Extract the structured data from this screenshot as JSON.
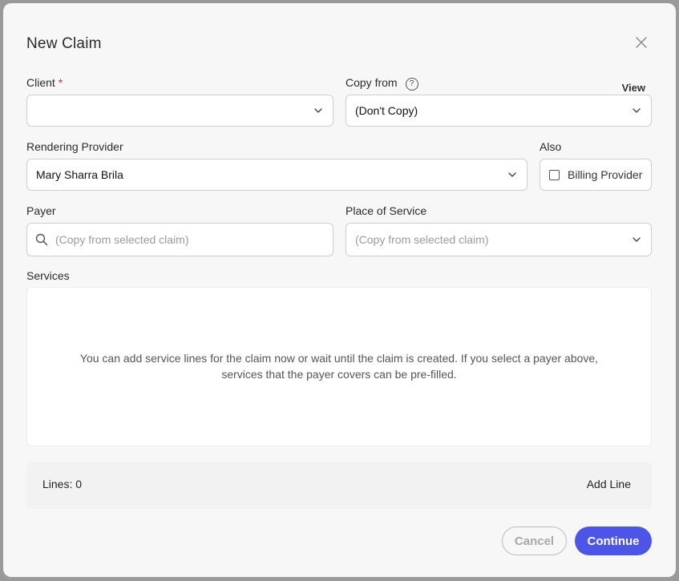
{
  "dialog": {
    "title": "New Claim"
  },
  "client": {
    "label": "Client",
    "required_mark": "*",
    "value": ""
  },
  "copy_from": {
    "label": "Copy from",
    "help_glyph": "?",
    "view_link": "View",
    "value": "(Don't Copy)"
  },
  "rendering_provider": {
    "label": "Rendering Provider",
    "value": "Mary Sharra Brila"
  },
  "also": {
    "label": "Also",
    "checkbox_label": "Billing Provider",
    "checked": false
  },
  "payer": {
    "label": "Payer",
    "placeholder": "(Copy from selected claim)"
  },
  "place_of_service": {
    "label": "Place of Service",
    "placeholder": "(Copy from selected claim)"
  },
  "services": {
    "label": "Services",
    "empty_message": "You can add service lines for the claim now or wait until the claim is created. If you select a payer above, services that the payer covers can be pre-filled."
  },
  "lines": {
    "count_text": "Lines: 0",
    "add_label": "Add Line"
  },
  "footer": {
    "cancel_label": "Cancel",
    "continue_label": "Continue"
  },
  "colors": {
    "primary": "#4c55e6",
    "required": "#e03131"
  },
  "icons": {
    "close": "close-icon",
    "chevron": "chevron-down-icon",
    "search": "search-icon",
    "help": "help-circle-icon"
  }
}
